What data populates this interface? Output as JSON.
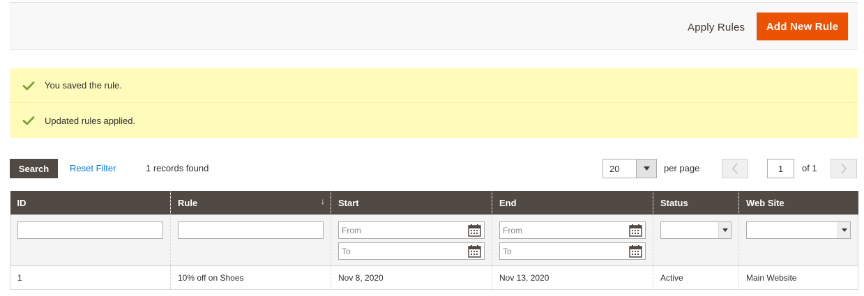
{
  "actions": {
    "apply_rules_label": "Apply Rules",
    "add_new_rule_label": "Add New Rule"
  },
  "messages": [
    {
      "text": "You saved the rule.",
      "icon": "checkmark-icon"
    },
    {
      "text": "Updated rules applied.",
      "icon": "checkmark-icon"
    }
  ],
  "toolbar": {
    "search_label": "Search",
    "reset_filter_label": "Reset Filter",
    "records_found": "1 records found",
    "per_page_value": "20",
    "per_page_label": "per page",
    "page_value": "1",
    "page_of": "of 1"
  },
  "table": {
    "columns": [
      "ID",
      "Rule",
      "Start",
      "End",
      "Status",
      "Web Site"
    ],
    "sorted_column": "Rule",
    "filters": {
      "from_placeholder": "From",
      "to_placeholder": "To"
    },
    "rows": [
      {
        "id": "1",
        "rule": "10% off on Shoes",
        "start": "Nov 8, 2020",
        "end": "Nov 13, 2020",
        "status": "Active",
        "website": "Main Website"
      }
    ]
  },
  "colors": {
    "accent": "#eb5202",
    "header_bg": "#514943",
    "message_bg": "#fffbbb",
    "success_check": "#79a22e",
    "link": "#007bdb"
  }
}
